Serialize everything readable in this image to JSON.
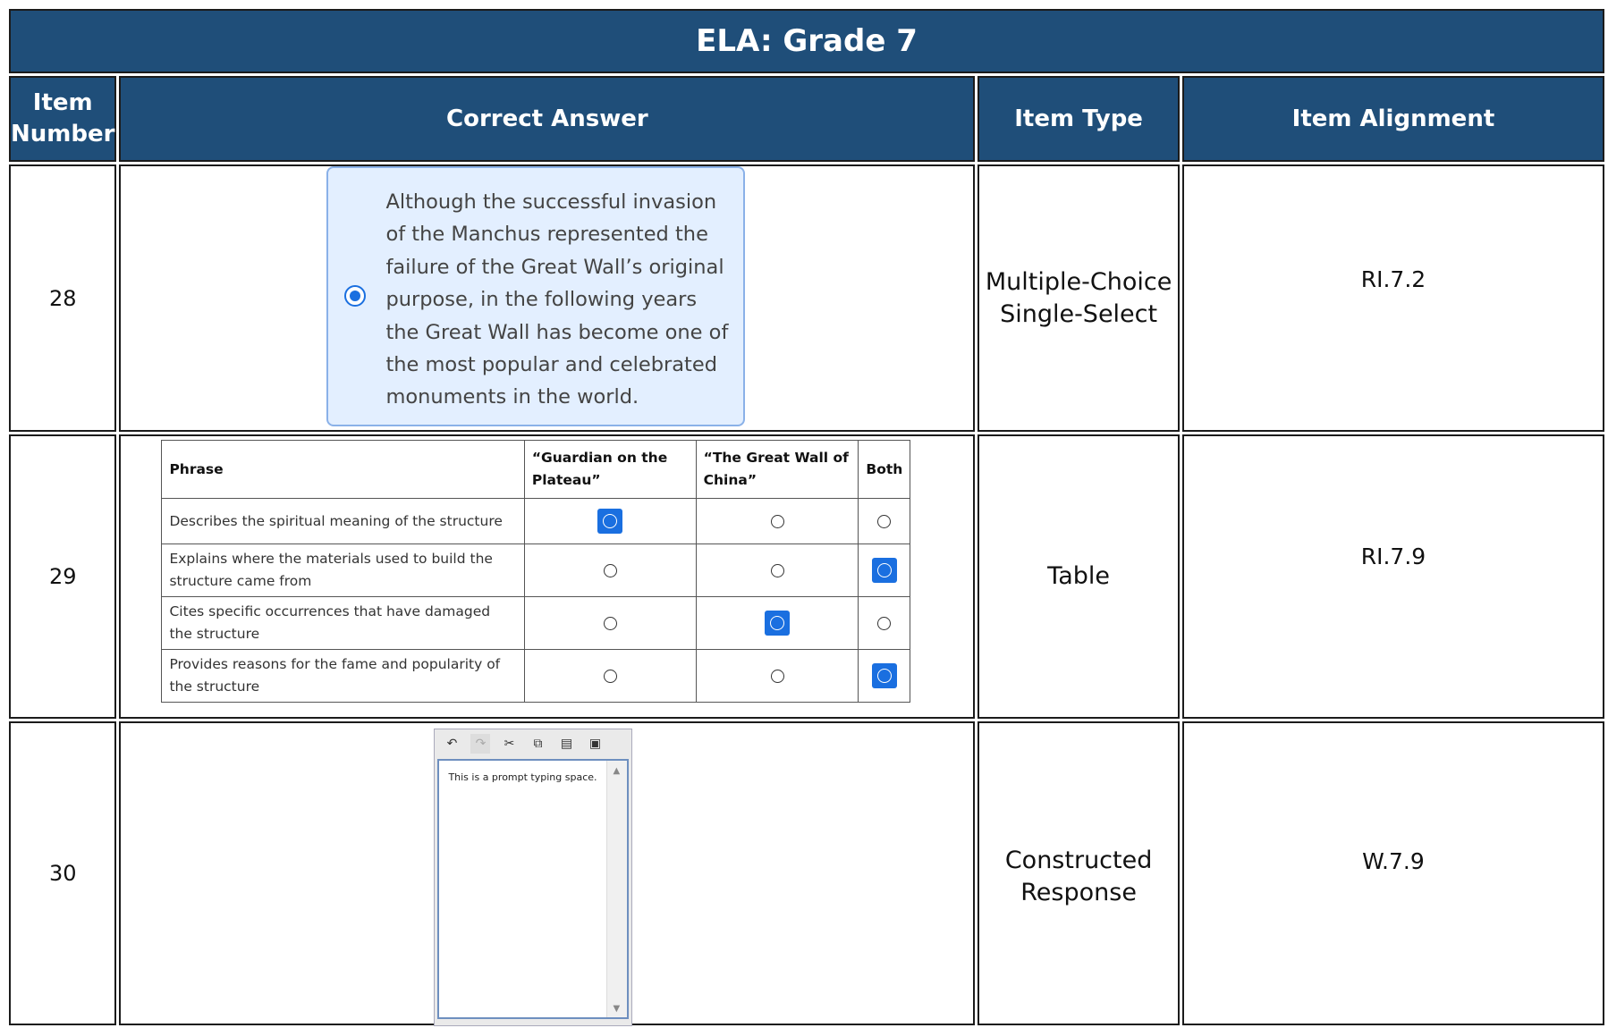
{
  "title": "ELA: Grade 7",
  "headers": {
    "item_number_line1": "Item",
    "item_number_line2": "Number",
    "correct_answer": "Correct Answer",
    "item_type": "Item Type",
    "item_alignment": "Item Alignment"
  },
  "rows": [
    {
      "number": "28",
      "answer_text": "Although the successful invasion of the Manchus represented the failure of the Great Wall’s original purpose, in the following years the Great Wall has become one of the most popular and celebrated monuments in the world.",
      "type_line1": "Multiple-Choice",
      "type_line2": "Single-Select",
      "alignment": "RI.7.2"
    },
    {
      "number": "29",
      "table": {
        "headers": [
          "Phrase",
          "“Guardian on the Plateau”",
          "“The Great Wall of China”",
          "Both"
        ],
        "rows": [
          {
            "phrase": "Describes the spiritual meaning of the structure",
            "selected": 1
          },
          {
            "phrase": "Explains where the materials used to build the structure came from",
            "selected": 3
          },
          {
            "phrase": "Cites specific occurrences that have damaged the structure",
            "selected": 2
          },
          {
            "phrase": "Provides reasons for the fame and popularity of the structure",
            "selected": 3
          }
        ]
      },
      "type_line1": "Table",
      "alignment": "RI.7.9"
    },
    {
      "number": "30",
      "editor_text": "This is a prompt typing space.",
      "type_line1": "Constructed",
      "type_line2": "Response",
      "alignment": "W.7.9"
    }
  ],
  "colors": {
    "header_bg": "#1f4e79",
    "accent": "#1a6fe0"
  },
  "icons": [
    "undo-icon",
    "redo-icon",
    "cut-icon",
    "copy-icon",
    "paste-icon",
    "spellcheck-icon"
  ]
}
